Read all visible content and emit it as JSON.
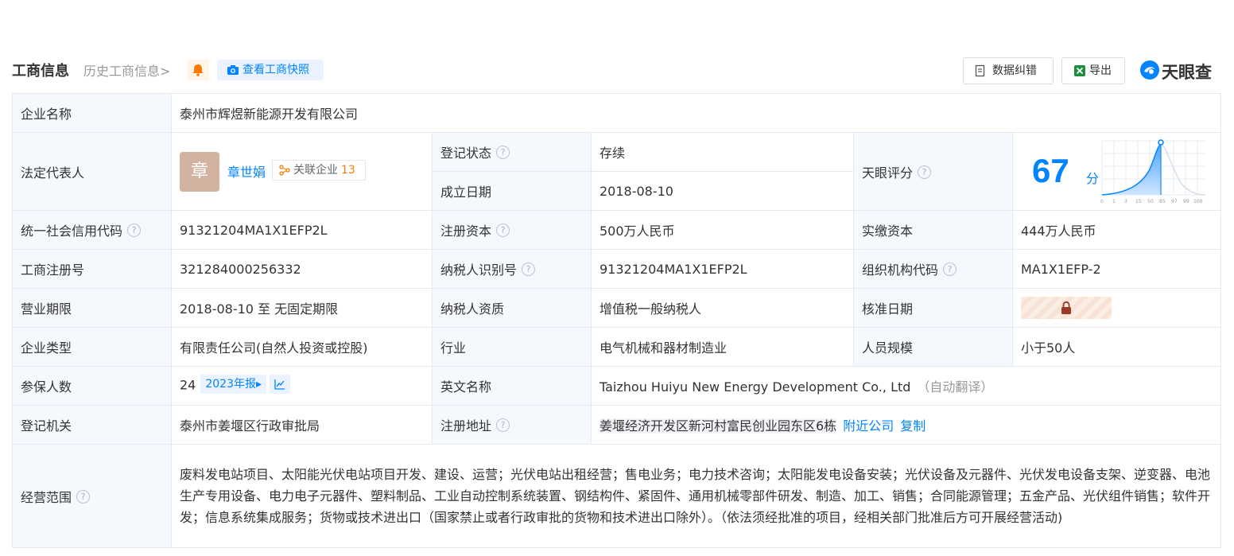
{
  "header": {
    "title": "工商信息",
    "history": "历史工商信息",
    "history_arrow": ">",
    "snapshot": "查看工商快照",
    "data_fix": "数据纠错",
    "export": "导出",
    "brand": "天眼查"
  },
  "rows": {
    "company_name": {
      "label": "企业名称",
      "value": "泰州市辉煜新能源开发有限公司"
    },
    "legal_rep": {
      "label": "法定代表人",
      "avatar_char": "章",
      "name": "章世娟",
      "related_label": "关联企业",
      "related_count": "13"
    },
    "reg_status": {
      "label": "登记状态",
      "value": "存续"
    },
    "founded": {
      "label": "成立日期",
      "value": "2018-08-10"
    },
    "score": {
      "label": "天眼评分",
      "value": "67",
      "unit": "分",
      "axis_ticks": [
        "0",
        "1",
        "3",
        "15",
        "50",
        "85",
        "97",
        "99",
        "100"
      ]
    },
    "credit_code": {
      "label": "统一社会信用代码",
      "value": "91321204MA1X1EFP2L"
    },
    "reg_capital": {
      "label": "注册资本",
      "value": "500万人民币"
    },
    "paid_capital": {
      "label": "实缴资本",
      "value": "444万人民币"
    },
    "reg_no": {
      "label": "工商注册号",
      "value": "321284000256332"
    },
    "taxpayer_id": {
      "label": "纳税人识别号",
      "value": "91321204MA1X1EFP2L"
    },
    "org_code": {
      "label": "组织机构代码",
      "value": "MA1X1EFP-2"
    },
    "term": {
      "label": "营业期限",
      "value": "2018-08-10 至 无固定期限"
    },
    "taxpayer_type": {
      "label": "纳税人资质",
      "value": "增值税一般纳税人"
    },
    "approve_date": {
      "label": "核准日期",
      "locked_icon": "lock-icon"
    },
    "company_type": {
      "label": "企业类型",
      "value": "有限责任公司(自然人投资或控股)"
    },
    "industry": {
      "label": "行业",
      "value": "电气机械和器材制造业"
    },
    "staff_size": {
      "label": "人员规模",
      "value": "小于50人"
    },
    "insured": {
      "label": "参保人数",
      "value": "24",
      "report": "2023年报",
      "report_arrow": "▸"
    },
    "english_name": {
      "label": "英文名称",
      "value": "Taizhou Huiyu New Energy Development Co., Ltd",
      "auto": "（自动翻译）"
    },
    "authority": {
      "label": "登记机关",
      "value": "泰州市姜堰区行政审批局"
    },
    "address": {
      "label": "注册地址",
      "value": "姜堰经济开发区新河村富民创业园东区6栋",
      "nearby": "附近公司",
      "copy": "复制"
    },
    "scope": {
      "label": "经营范围",
      "value": "废料发电站项目、太阳能光伏电站项目开发、建设、运营；光伏电站出租经营；售电业务；电力技术咨询；太阳能发电设备安装；光伏设备及元器件、光伏发电设备支架、逆变器、电池生产专用设备、电力电子元器件、塑料制品、工业自动控制系统装置、钢结构件、紧固件、通用机械零部件研发、制造、加工、销售；合同能源管理；五金产品、光伏组件销售；软件开发；信息系统集成服务；货物或技术进出口（国家禁止或者行政审批的货物和技术进出口除外）。（依法须经批准的项目，经相关部门批准后方可开展经营活动)"
    }
  },
  "help_icon": "?",
  "colors": {
    "accent": "#0084ff",
    "status_green": "#1aa358",
    "orange": "#ff7a00",
    "label_bg": "#f5f8fc"
  }
}
